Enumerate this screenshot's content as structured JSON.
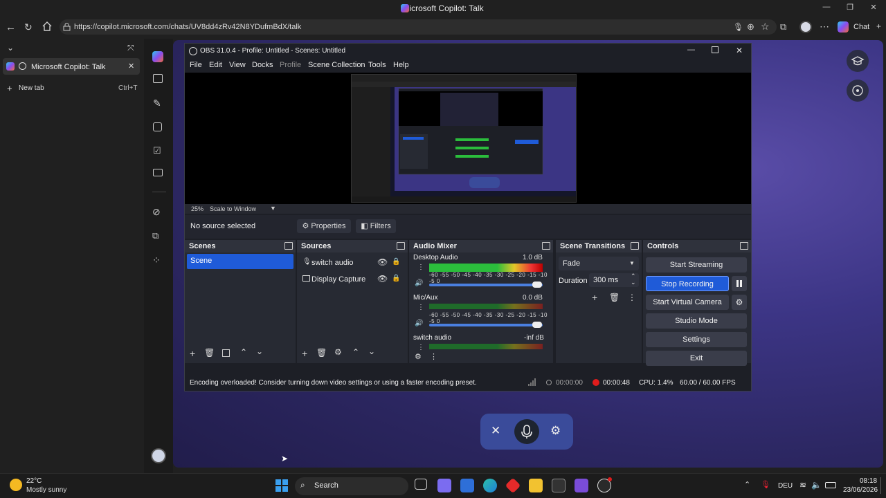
{
  "browser": {
    "window_title": "Microsoft Copilot: Talk",
    "url": "https://copilot.microsoft.com/chats/UV8dd4zRv42N8YDufmBdX/talk",
    "chat_label": "Chat",
    "tabs": [
      {
        "label": "Microsoft Copilot: Talk"
      }
    ],
    "new_tab_label": "New tab",
    "new_tab_shortcut": "Ctrl+T"
  },
  "obs": {
    "title": "OBS 31.0.4 - Profile: Untitled - Scenes: Untitled",
    "menu": [
      "File",
      "Edit",
      "View",
      "Docks",
      "Profile",
      "Scene Collection",
      "Tools",
      "Help"
    ],
    "zoom": "25%",
    "scale_mode": "Scale to Window",
    "no_source": "No source selected",
    "properties_label": "Properties",
    "filters_label": "Filters",
    "scenes_title": "Scenes",
    "scenes": [
      "Scene"
    ],
    "sources_title": "Sources",
    "sources": [
      "switch audio",
      "Display Capture"
    ],
    "mixer_title": "Audio Mixer",
    "mixer": [
      {
        "name": "Desktop Audio",
        "level": "1.0 dB"
      },
      {
        "name": "Mic/Aux",
        "level": "0.0 dB"
      },
      {
        "name": "switch audio",
        "level": "-inf dB"
      }
    ],
    "tick_labels": "-60 -55 -50 -45 -40 -35 -30 -25 -20 -15 -10 -5  0",
    "transitions_title": "Scene Transitions",
    "transition": "Fade",
    "duration_label": "Duration",
    "duration_value": "300 ms",
    "controls_title": "Controls",
    "controls": {
      "start_streaming": "Start Streaming",
      "stop_recording": "Stop Recording",
      "start_virtual_camera": "Start Virtual Camera",
      "studio_mode": "Studio Mode",
      "settings": "Settings",
      "exit": "Exit"
    },
    "status": {
      "message": "Encoding overloaded! Consider turning down video settings or using a faster encoding preset.",
      "stream_time": "00:00:00",
      "rec_time": "00:00:48",
      "cpu": "CPU: 1.4%",
      "fps": "60.00 / 60.00 FPS"
    }
  },
  "taskbar": {
    "temperature": "22°C",
    "weather": "Mostly sunny",
    "search_label": "Search",
    "language": "DEU",
    "time": "08:18",
    "date": "23/06/2026"
  },
  "colors": {
    "accent": "#1f5bd8",
    "record_red": "#e01c1c",
    "page_bg": "#3c3585"
  }
}
